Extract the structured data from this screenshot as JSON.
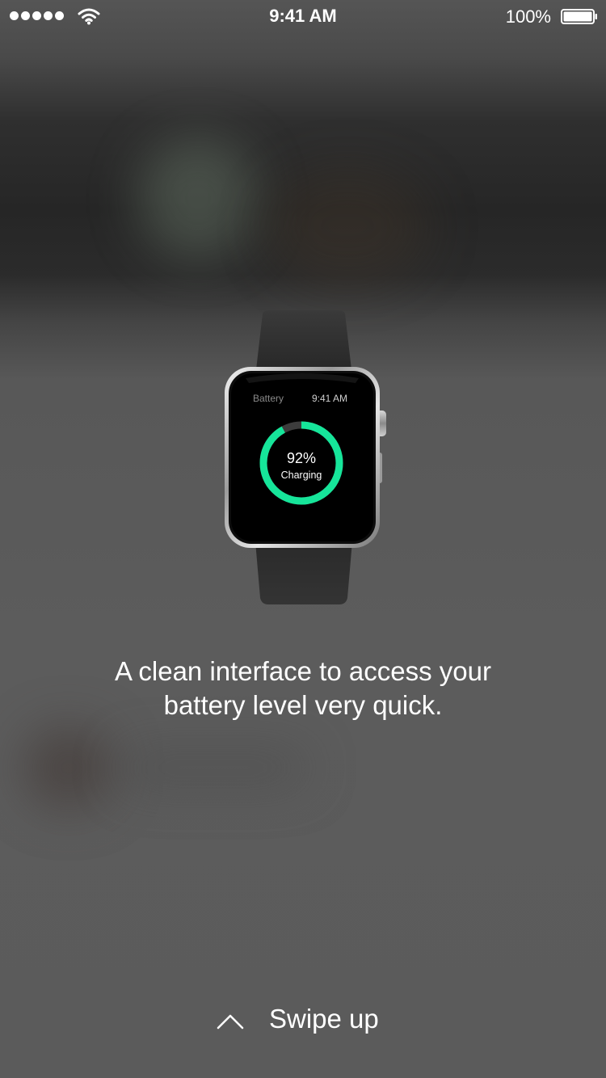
{
  "status_bar": {
    "time": "9:41 AM",
    "battery_percent": "100%",
    "signal_bars": 5,
    "signal_icon": "signal-dots-icon",
    "wifi_icon": "wifi-icon",
    "battery_icon": "battery-full-icon"
  },
  "watch": {
    "app_title": "Battery",
    "time": "9:41 AM",
    "level_text": "92%",
    "level_fraction": 0.92,
    "status": "Charging",
    "accent_color": "#16e59a"
  },
  "onboarding": {
    "caption_line1": "A clean interface to access your",
    "caption_line2": "battery level very quick."
  },
  "swipe": {
    "label": "Swipe up",
    "icon": "chevron-up-icon"
  }
}
